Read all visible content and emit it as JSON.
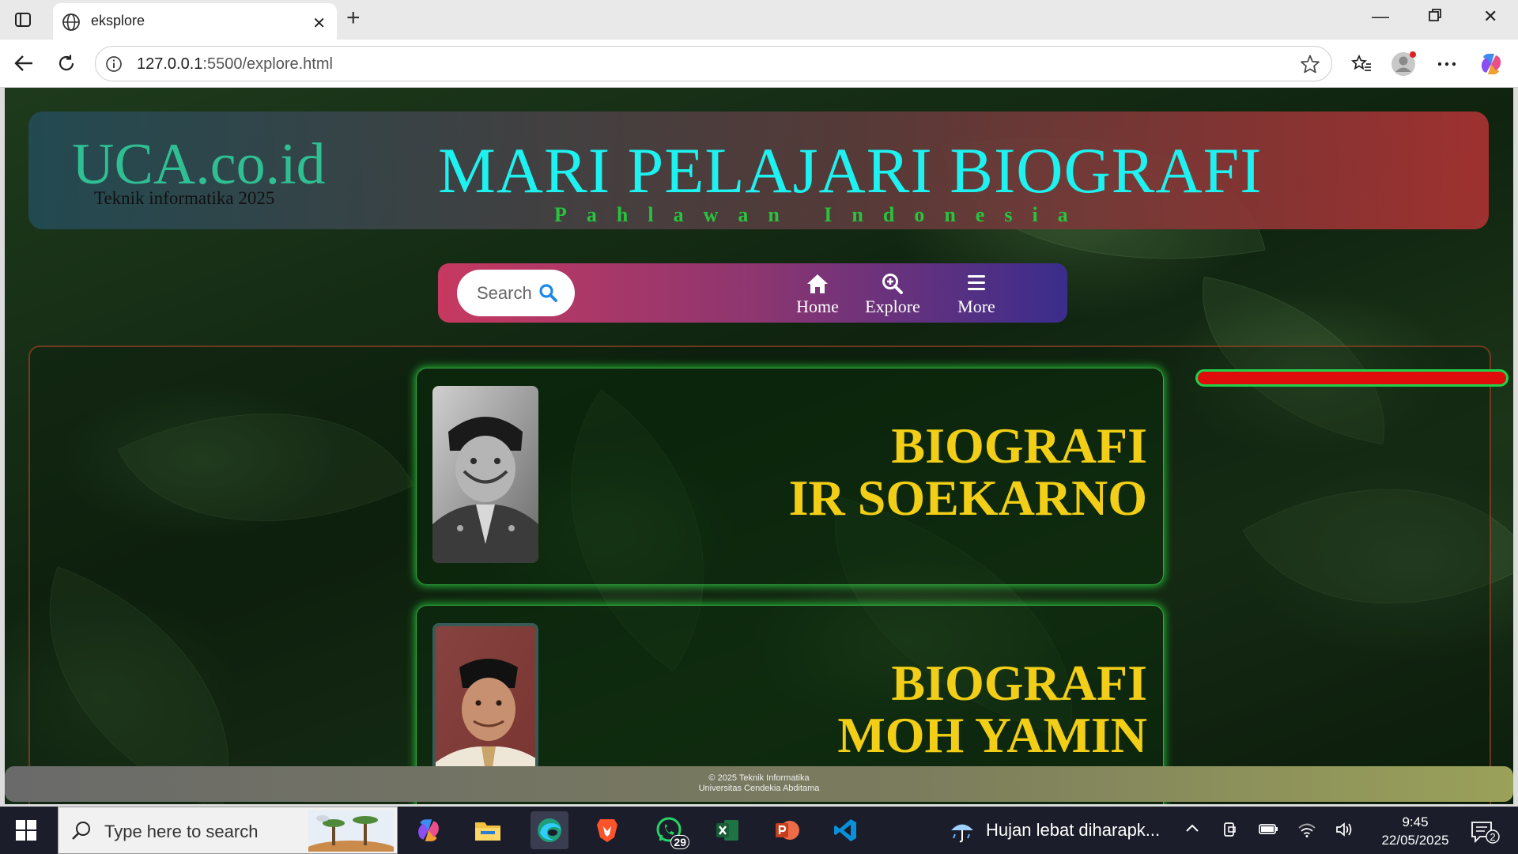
{
  "browser": {
    "tab_title": "eksplore",
    "url_host": "127.0.0.1",
    "url_path": ":5500/explore.html"
  },
  "header": {
    "logo": "UCA.co.id",
    "logo_sub": "Teknik informatika 2025",
    "title": "MARI PELAJARI BIOGRAFI",
    "subtitle": "Pahlawan Indonesia"
  },
  "nav": {
    "search_label": "Search",
    "items": [
      {
        "label": "Home",
        "icon": "home-icon"
      },
      {
        "label": "Explore",
        "icon": "zoom-in-icon"
      },
      {
        "label": "More",
        "icon": "menu-icon"
      }
    ]
  },
  "progress": {
    "value": 1.0,
    "fill_color": "#e00b0b",
    "border_color": "#20d14a"
  },
  "cards": [
    {
      "line1": "BIOGRAFI",
      "line2": "IR SOEKARNO"
    },
    {
      "line1": "BIOGRAFI",
      "line2": "MOH YAMIN"
    }
  ],
  "footer": {
    "line1": "© 2025 Teknik Informatika",
    "line2": "Universitas Cendekia Abditama"
  },
  "taskbar": {
    "search_placeholder": "Type here to search",
    "whatsapp_badge": "29",
    "weather": "Hujan lebat diharapk...",
    "time": "9:45",
    "date": "22/05/2025",
    "notifications": "2"
  },
  "colors": {
    "title": "#1ef2f0",
    "subtitle": "#27c43d",
    "logo": "#2fbf93",
    "card_title": "#f2cf16",
    "card_glow": "#28d23c"
  }
}
